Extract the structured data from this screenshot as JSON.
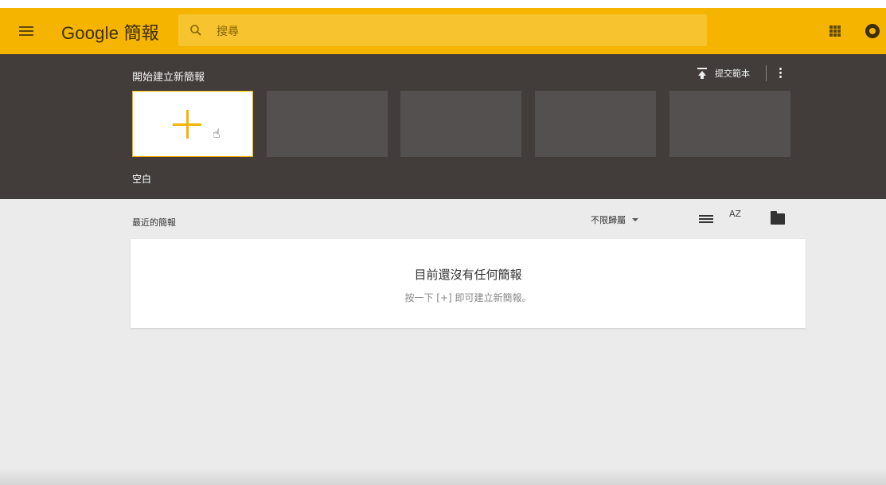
{
  "app": {
    "logo_brand": "Google",
    "logo_product": "簡報"
  },
  "search": {
    "placeholder": "搜尋"
  },
  "colors": {
    "accent": "#f4b400",
    "gallery_bg": "#423d3b",
    "page_bg": "#ebebeb"
  },
  "gallery": {
    "title": "開始建立新簡報",
    "submit_template": "提交範本",
    "blank_label": "空白"
  },
  "recent": {
    "title": "最近的簡報",
    "owner_filter": "不限歸屬",
    "sort_icon_text": "AZ",
    "empty_title": "目前還沒有任何簡報",
    "empty_subtitle": "按一下 [+] 即可建立新簡報。"
  },
  "icons": [
    "menu-icon",
    "search-icon",
    "apps-icon",
    "account-icon",
    "upload-icon",
    "more-vert-icon",
    "plus-icon",
    "hand-cursor-icon",
    "list-view-icon",
    "sort-az-icon",
    "folder-icon",
    "caret-down-icon"
  ]
}
